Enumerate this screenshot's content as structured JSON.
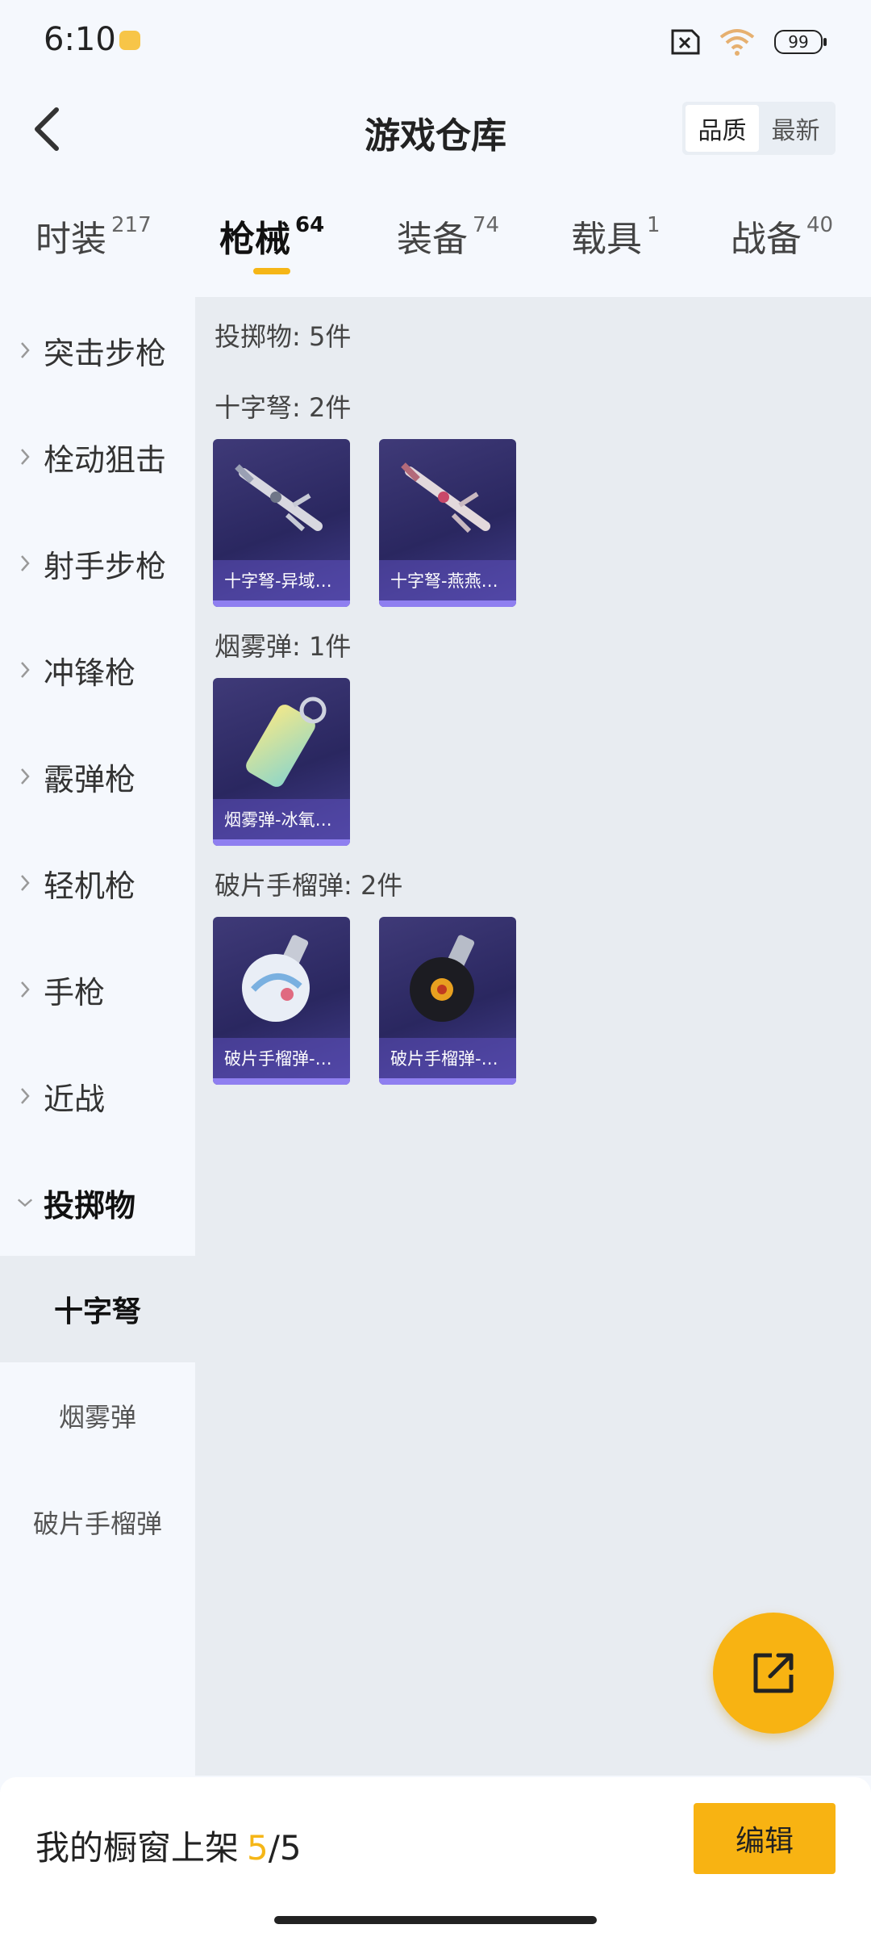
{
  "status": {
    "time": "6:10",
    "battery": "99"
  },
  "header": {
    "title": "游戏仓库",
    "sort": [
      "品质",
      "最新"
    ]
  },
  "tabs": [
    {
      "label": "时装",
      "count": "217"
    },
    {
      "label": "枪械",
      "count": "64"
    },
    {
      "label": "装备",
      "count": "74"
    },
    {
      "label": "载具",
      "count": "1"
    },
    {
      "label": "战备",
      "count": "40"
    }
  ],
  "sidebar": {
    "items": [
      "突击步枪",
      "栓动狙击",
      "射手步枪",
      "冲锋枪",
      "霰弹枪",
      "轻机枪",
      "手枪",
      "近战",
      "投掷物"
    ],
    "subitems": [
      "十字弩",
      "烟雾弹",
      "破片手榴弹"
    ]
  },
  "content": {
    "summary": "投掷物: 5件",
    "sections": [
      {
        "title": "十字弩: 2件",
        "items": [
          "十字弩-异域…",
          "十字弩-燕燕…"
        ]
      },
      {
        "title": "烟雾弹: 1件",
        "items": [
          "烟雾弹-冰氧…"
        ]
      },
      {
        "title": "破片手榴弹: 2件",
        "items": [
          "破片手榴弹-…",
          "破片手榴弹-…"
        ]
      }
    ]
  },
  "bottom": {
    "label": "我的橱窗上架",
    "count": "5",
    "total": "/5",
    "edit": "编辑"
  },
  "icons": {
    "fab": "share-export-icon",
    "back": "back-arrow-icon"
  },
  "colors": {
    "accent": "#f8b312",
    "card_bg": "#2a2760"
  }
}
